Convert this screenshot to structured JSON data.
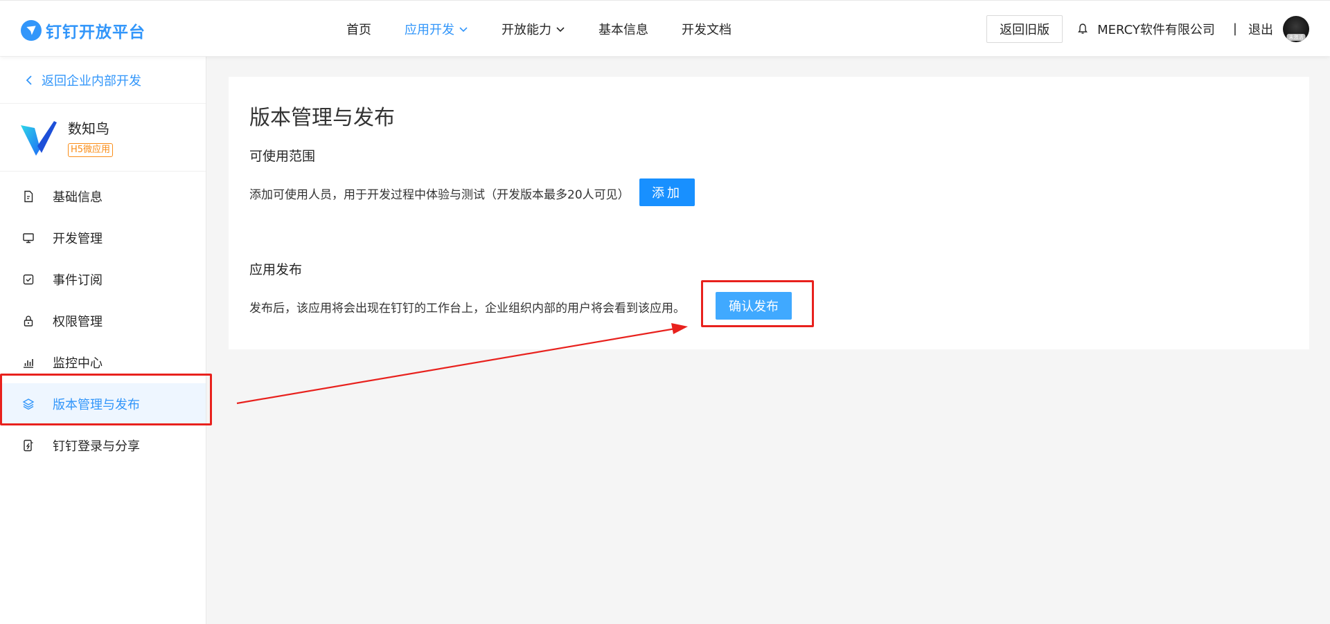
{
  "header": {
    "logo_text": "钉钉开放平台",
    "nav": [
      {
        "label": "首页",
        "active": false,
        "has_dropdown": false
      },
      {
        "label": "应用开发",
        "active": true,
        "has_dropdown": true
      },
      {
        "label": "开放能力",
        "active": false,
        "has_dropdown": true
      },
      {
        "label": "基本信息",
        "active": false,
        "has_dropdown": false
      },
      {
        "label": "开发文档",
        "active": false,
        "has_dropdown": false
      }
    ],
    "old_version_label": "返回旧版",
    "company_name": "MERCY软件有限公司",
    "separator": "|",
    "logout_label": "退出",
    "avatar_tag": "未激活"
  },
  "sidebar": {
    "back_label": "返回企业内部开发",
    "app_name": "数知鸟",
    "app_type": "H5微应用",
    "items": [
      {
        "label": "基础信息",
        "icon": "file-icon",
        "active": false
      },
      {
        "label": "开发管理",
        "icon": "monitor-icon",
        "active": false
      },
      {
        "label": "事件订阅",
        "icon": "calendar-check-icon",
        "active": false
      },
      {
        "label": "权限管理",
        "icon": "lock-icon",
        "active": false
      },
      {
        "label": "监控中心",
        "icon": "bar-chart-icon",
        "active": false
      },
      {
        "label": "版本管理与发布",
        "icon": "layers-icon",
        "active": true
      },
      {
        "label": "钉钉登录与分享",
        "icon": "phone-share-icon",
        "active": false
      }
    ]
  },
  "main": {
    "page_title": "版本管理与发布",
    "scope_title": "可使用范围",
    "scope_desc": "添加可使用人员，用于开发过程中体验与测试（开发版本最多20人可见）",
    "add_button_label": "添加",
    "publish_title": "应用发布",
    "publish_desc": "发布后，该应用将会出现在钉钉的工作台上，企业组织内部的用户将会看到该应用。",
    "publish_button_label": "确认发布"
  },
  "colors": {
    "brand_blue": "#3296fa",
    "primary_button": "#1890ff",
    "publish_button": "#40a9ff",
    "annotation_red": "#e8211d",
    "type_tag_orange": "#fa8c16"
  }
}
